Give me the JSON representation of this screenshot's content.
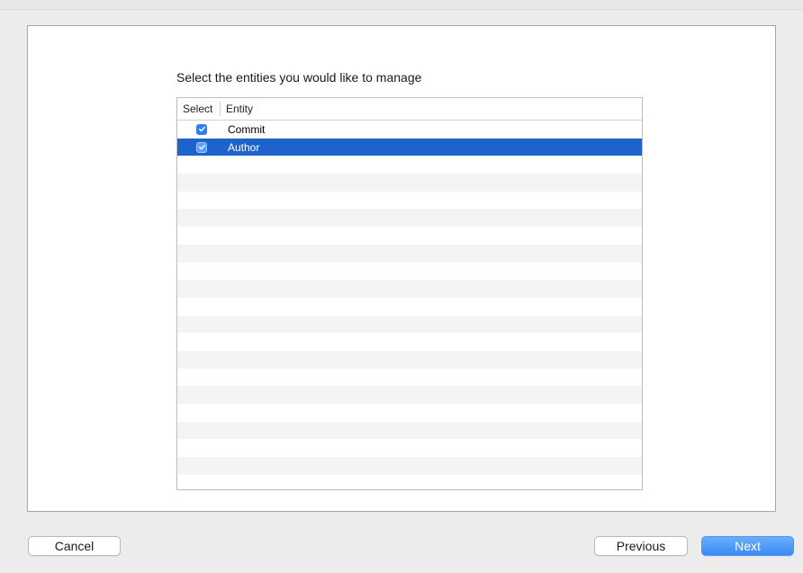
{
  "dialog": {
    "prompt": "Select the entities you would like to manage",
    "table": {
      "columns": [
        "Select",
        "Entity"
      ],
      "rows": [
        {
          "entity": "Commit",
          "checked": true,
          "selected": false
        },
        {
          "entity": "Author",
          "checked": true,
          "selected": true
        }
      ]
    }
  },
  "footer": {
    "cancel_label": "Cancel",
    "previous_label": "Previous",
    "next_label": "Next"
  },
  "colors": {
    "selection": "#1e63cc",
    "accent": "#2f7ef5"
  }
}
